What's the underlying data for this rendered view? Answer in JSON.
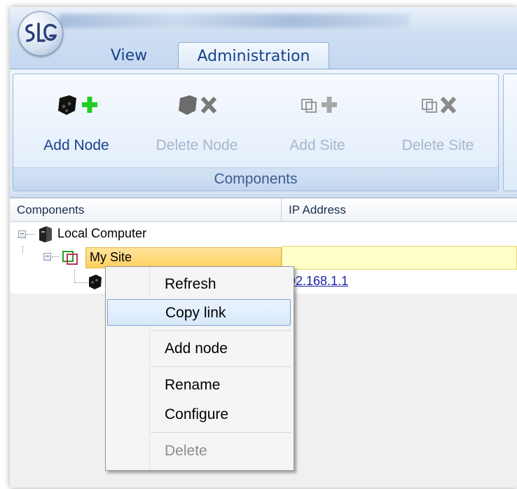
{
  "tabs": [
    {
      "label": "View"
    },
    {
      "label": "Administration"
    }
  ],
  "ribbon": {
    "buttons": [
      {
        "label": "Add Node",
        "icon": "add-node-icon",
        "enabled": true
      },
      {
        "label": "Delete Node",
        "icon": "delete-node-icon",
        "enabled": false
      },
      {
        "label": "Add Site",
        "icon": "add-site-icon",
        "enabled": false
      },
      {
        "label": "Delete Site",
        "icon": "delete-site-icon",
        "enabled": false
      }
    ],
    "group_label": "Components"
  },
  "table": {
    "headers": [
      "Components",
      "IP Address"
    ],
    "rows": [
      {
        "name": "Local Computer",
        "ip": ""
      },
      {
        "name": "My Site",
        "ip": ""
      },
      {
        "name": "",
        "ip": "192.168.1.1"
      }
    ]
  },
  "context_menu": {
    "items": [
      {
        "label": "Refresh",
        "enabled": true
      },
      {
        "label": "Copy link",
        "enabled": true,
        "highlighted": true
      },
      {
        "label": "Add node",
        "enabled": true
      },
      {
        "label": "Rename",
        "enabled": true
      },
      {
        "label": "Configure",
        "enabled": true
      },
      {
        "label": "Delete",
        "enabled": false
      }
    ]
  },
  "colors": {
    "ribbon_text": "#15428b",
    "selection": "#ffd060",
    "link": "#1a24a8",
    "add_green": "#22cc22"
  }
}
